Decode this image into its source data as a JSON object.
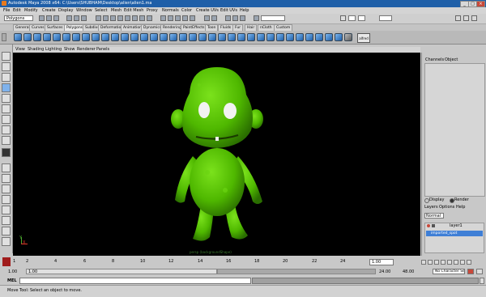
{
  "window": {
    "title": "Autodesk Maya 2008 x64: C:\\Users\\SHUBHAM\\Desktop\\alien\\alien1.ma"
  },
  "menubar": {
    "items": [
      "File",
      "Edit",
      "Modify",
      "Create",
      "Display",
      "Window",
      "Select",
      "Mesh",
      "Edit Mesh",
      "Proxy",
      "Normals",
      "Color",
      "Create UVs",
      "Edit UVs",
      "Help"
    ]
  },
  "statusline": {
    "mode": "Polygons"
  },
  "shelf": {
    "tabs": [
      "General",
      "Curves",
      "Surfaces",
      "Polygons",
      "Subdivs",
      "Deformation",
      "Animation",
      "Dynamics",
      "Rendering",
      "PaintEffects",
      "Toon",
      "Fluids",
      "Fur",
      "Hair",
      "nCloth",
      "Custom"
    ],
    "active_tab": "Polygons",
    "end_label": "alfred"
  },
  "viewport": {
    "menu": [
      "View",
      "Shading",
      "Lighting",
      "Show",
      "Renderer",
      "Panels"
    ],
    "axis_x": "X",
    "axis_y": "Y",
    "camera_label": "persp  (backgroundShape)"
  },
  "channelbox": {
    "tabs": [
      "Channels",
      "Object"
    ]
  },
  "layers": {
    "display_label": "Display",
    "render_label": "Render",
    "menu": [
      "Layers",
      "Options",
      "Help"
    ],
    "mode": "Normal",
    "layer_name": "layer1",
    "selected_item": "imported_spot"
  },
  "timeslider": {
    "ticks": [
      "1",
      "2",
      "4",
      "6",
      "8",
      "10",
      "12",
      "14",
      "16",
      "18",
      "20",
      "22",
      "24"
    ],
    "current_frame": "1.00"
  },
  "rangeslider": {
    "start": "1.00",
    "range_start_field": "1.00",
    "end": "24.00",
    "end_field": "48.00",
    "character_set": "No Character Set"
  },
  "cmdline": {
    "label": "MEL"
  },
  "helpline": {
    "text": "Move Tool: Select an object to move."
  },
  "colors": {
    "viewport_bg": "#000000",
    "character": "#4fb800",
    "titlebar": "#1f5fa8",
    "selection": "#3f7fd6"
  }
}
